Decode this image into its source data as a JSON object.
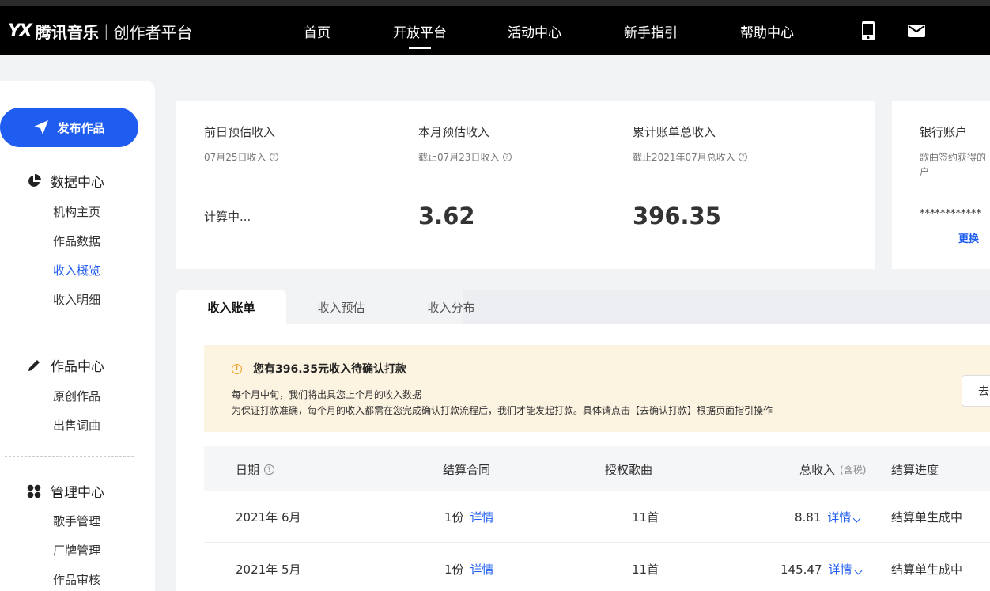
{
  "header": {
    "logo_mark": "YX",
    "brand": "腾讯音乐",
    "separator": "|",
    "subtitle": "创作者平台",
    "nav": [
      {
        "label": "首页",
        "active": false
      },
      {
        "label": "开放平台",
        "active": true
      },
      {
        "label": "活动中心",
        "active": false
      },
      {
        "label": "新手指引",
        "active": false
      },
      {
        "label": "帮助中心",
        "active": false
      }
    ],
    "icons": [
      "phone-icon",
      "mail-icon"
    ]
  },
  "sidebar": {
    "publish_label": "发布作品",
    "sections": [
      {
        "title": "数据中心",
        "icon": "pie-chart-icon",
        "items": [
          "机构主页",
          "作品数据",
          "收入概览",
          "收入明细"
        ],
        "active_item": "收入概览"
      },
      {
        "title": "作品中心",
        "icon": "pencil-icon",
        "items": [
          "原创作品",
          "出售词曲"
        ]
      },
      {
        "title": "管理中心",
        "icon": "grid-icon",
        "items": [
          "歌手管理",
          "厂牌管理",
          "作品审核"
        ]
      }
    ]
  },
  "stats": [
    {
      "title": "前日预估收入",
      "sub": "07月25日收入",
      "value": "计算中..."
    },
    {
      "title": "本月预估收入",
      "sub": "截止07月23日收入",
      "value": "3.62"
    },
    {
      "title": "累计账单总收入",
      "sub": "截止2021年07月总收入",
      "value": "396.35"
    }
  ],
  "bank": {
    "title": "银行账户",
    "desc_line1": "歌曲签约获得的",
    "desc_line2": "户",
    "masked": "************",
    "change_label": "更换"
  },
  "tabs": [
    {
      "label": "收入账单",
      "active": true
    },
    {
      "label": "收入预估",
      "active": false
    },
    {
      "label": "收入分布",
      "active": false
    }
  ],
  "notice": {
    "title": "您有396.35元收入待确认打款",
    "line1": "每个月中旬，我们将出具您上个月的收入数据",
    "line2": "为保证打款准确，每个月的收入都需在您完成确认打款流程后，我们才能发起打款。具体请点击【去确认打款】根据页面指引操作",
    "button_label": "去"
  },
  "table": {
    "headers": {
      "date": "日期",
      "contract": "结算合同",
      "songs": "授权歌曲",
      "total": "总收入",
      "total_note": "(含税)",
      "progress": "结算进度"
    },
    "rows": [
      {
        "date": "2021年 6月",
        "contract": "1份",
        "contract_link": "详情",
        "songs": "11首",
        "total": "8.81",
        "total_link": "详情",
        "progress": "结算单生成中"
      },
      {
        "date": "2021年 5月",
        "contract": "1份",
        "contract_link": "详情",
        "songs": "11首",
        "total": "145.47",
        "total_link": "详情",
        "progress": "结算单生成中"
      }
    ]
  },
  "colors": {
    "accent": "#1f5cf0",
    "topbar": "#000000",
    "notice_bg": "#fdf3e1",
    "warning": "#f0a020"
  }
}
